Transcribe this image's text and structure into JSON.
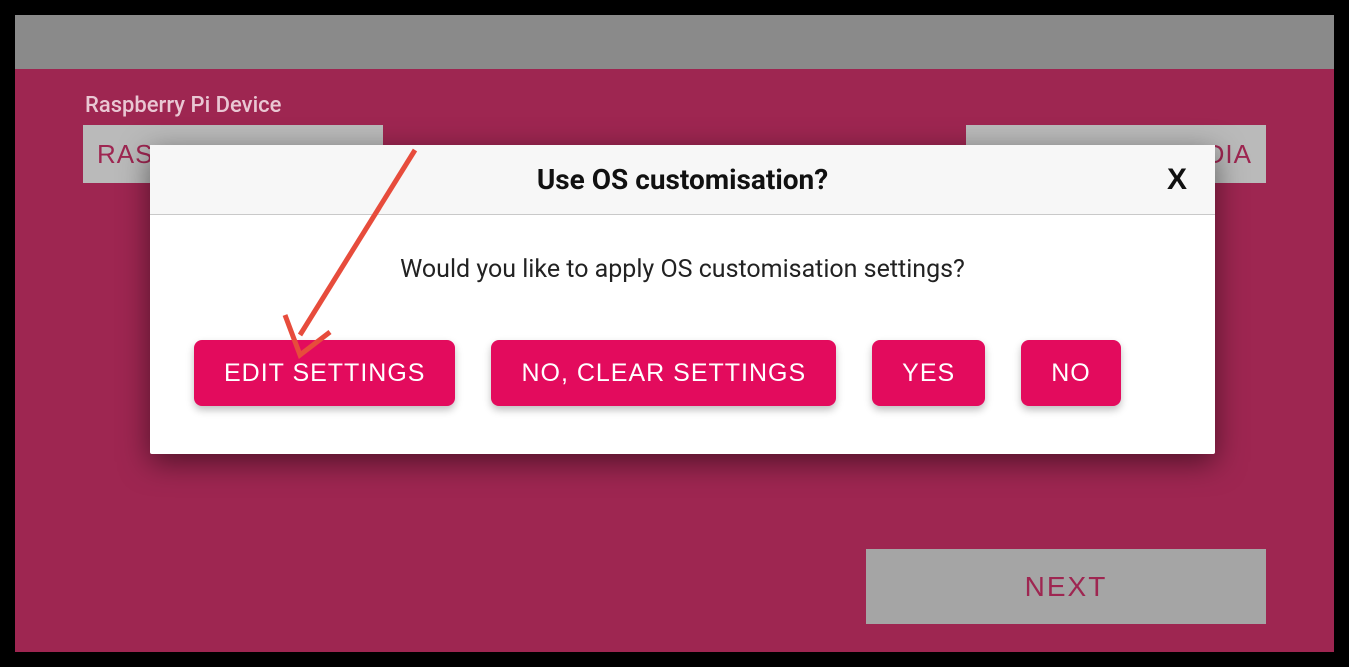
{
  "background": {
    "label": "Raspberry Pi Device",
    "device_button_partial": "RASPBERRY PI",
    "storage_button_partial": "MEDIA",
    "next_button": "NEXT"
  },
  "dialog": {
    "title": "Use OS customisation?",
    "close_label": "X",
    "message": "Would you like to apply OS customisation settings?",
    "buttons": {
      "edit_settings": "EDIT SETTINGS",
      "no_clear": "NO, CLEAR SETTINGS",
      "yes": "YES",
      "no": "NO"
    }
  },
  "annotation": {
    "arrow_color": "#e74c3c"
  }
}
